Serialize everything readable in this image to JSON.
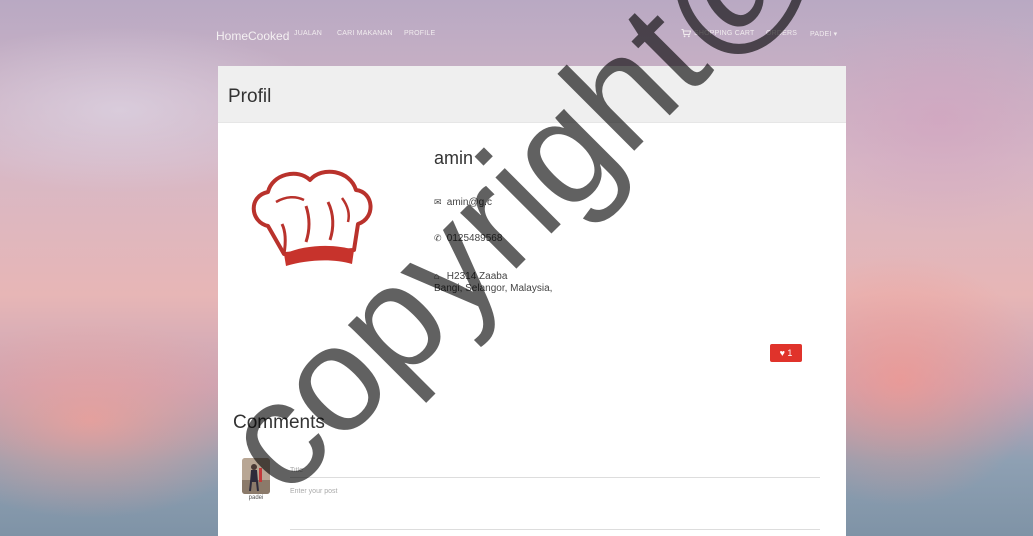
{
  "navbar": {
    "brand": "HomeCooked",
    "links": [
      "JUALAN",
      "CARI MAKANAN",
      "PROFILE"
    ],
    "cart": "SHOPPING CART",
    "orders": "ORDERS",
    "user": "PADEI ▾"
  },
  "profile": {
    "heading": "Profil",
    "name": "amin",
    "email": "amin@g.c",
    "phone": "0125489568",
    "address_line1": "H2314 Zaaba",
    "address_line2": "Bangi, Selangor, Malaysia,",
    "likes": "1"
  },
  "comments": {
    "heading": "Comments",
    "user": "padei",
    "title_placeholder": "Title",
    "post_placeholder": "Enter your post"
  },
  "watermark": "copyright@"
}
